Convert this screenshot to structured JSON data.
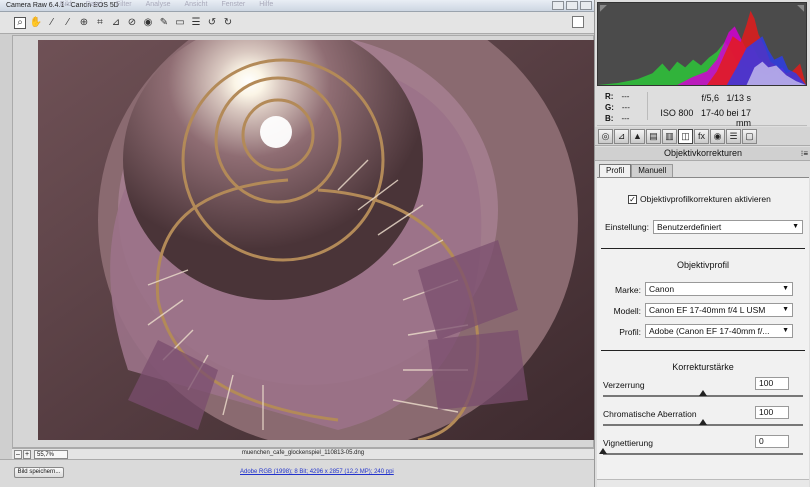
{
  "window": {
    "title": "Camera Raw 6.4.1 - Canon EOS 5D"
  },
  "menu": [
    "Bild",
    "Datei",
    "Filter",
    "Analyse",
    "Ansicht",
    "Fenster",
    "Hilfe"
  ],
  "toolbar": {
    "tools": [
      "zoom-icon",
      "hand-icon",
      "white-balance-icon",
      "color-sampler-icon",
      "target-adjust-icon",
      "crop-icon",
      "straighten-icon",
      "spot-removal-icon",
      "red-eye-icon",
      "adjustment-brush-icon",
      "graduated-filter-icon",
      "preferences-icon",
      "rotate-left-icon",
      "rotate-right-icon"
    ]
  },
  "status": {
    "zoom": "55,7%",
    "zoom_minus": "–",
    "zoom_plus": "+",
    "filename": "muenchen_cafe_glockenspiel_110813-05.dng"
  },
  "footer": {
    "save_label": "Bild speichern...",
    "workflow_link": "Adobe RGB (1998); 8 Bit; 4296 x 2857 (12,2 MP); 240 ppi"
  },
  "info": {
    "r_label": "R:",
    "r_value": "---",
    "g_label": "G:",
    "g_value": "---",
    "b_label": "B:",
    "b_value": "---",
    "aperture": "f/5,6",
    "shutter": "1/13 s",
    "iso": "ISO 800",
    "lens": "17-40 bei 17 mm"
  },
  "panel": {
    "tabs": [
      "basic-icon",
      "tone-curve-icon",
      "detail-icon",
      "hsl-icon",
      "split-toning-icon",
      "lens-corrections-icon",
      "fx-icon",
      "camera-calibration-icon",
      "presets-icon",
      "snapshots-icon"
    ],
    "tab_glyphs": [
      "◎",
      "⊿",
      "▲",
      "▤",
      "▥",
      "◫",
      "fx",
      "◉",
      "☰",
      "▢"
    ],
    "section_title": "Objektivkorrekturen",
    "section_menu": "⁝≡",
    "subtabs": [
      "Profil",
      "Manuell"
    ],
    "enable_checkbox_label": "Objektivprofilkorrekturen aktivieren",
    "enable_checked": "✓",
    "setting_label": "Einstellung:",
    "setting_value": "Benutzerdefiniert",
    "profile_heading": "Objektivprofil",
    "make_label": "Marke:",
    "make_value": "Canon",
    "model_label": "Modell:",
    "model_value": "Canon EF 17-40mm f/4 L USM",
    "profile_label": "Profil:",
    "profile_value": "Adobe (Canon EF 17-40mm f/...",
    "strength_heading": "Korrekturstärke",
    "sliders": [
      {
        "label": "Verzerrung",
        "value": "100",
        "fraction": 0.5
      },
      {
        "label": "Chromatische Aberration",
        "value": "100",
        "fraction": 0.5
      },
      {
        "label": "Vignettierung",
        "value": "0",
        "fraction": 0.0
      }
    ]
  },
  "colors": {
    "photo_wall": "#7a5a5e",
    "stair_pink": "#a77a9a",
    "railing": "#8a6a44"
  }
}
